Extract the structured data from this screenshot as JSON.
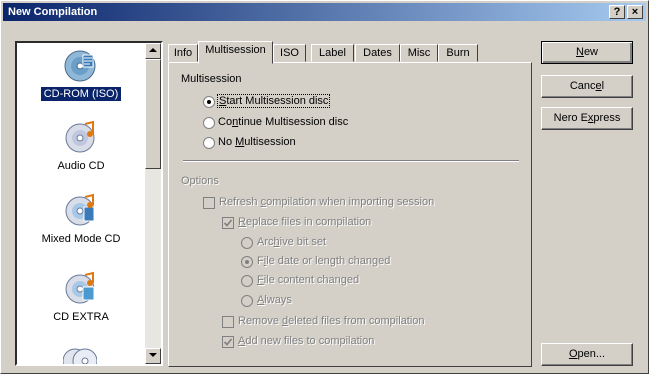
{
  "window": {
    "title": "New Compilation",
    "help_label": "?",
    "close_label": "×"
  },
  "list": {
    "items": [
      {
        "label": "CD-ROM (ISO)",
        "selected": true,
        "icon": "disc-iso-icon"
      },
      {
        "label": "Audio CD",
        "selected": false,
        "icon": "audio-cd-icon"
      },
      {
        "label": "Mixed Mode CD",
        "selected": false,
        "icon": "mixed-mode-cd-icon"
      },
      {
        "label": "CD EXTRA",
        "selected": false,
        "icon": "cd-extra-icon"
      },
      {
        "label": "",
        "selected": false,
        "icon": "disc-icon"
      }
    ]
  },
  "tabs": [
    "Info",
    "Multisession",
    "ISO",
    "Label",
    "Dates",
    "Misc",
    "Burn"
  ],
  "active_tab": "Multisession",
  "multisession": {
    "group_label": "Multisession",
    "options": [
      {
        "pre": "",
        "u": "S",
        "post": "tart Multisession disc",
        "checked": true
      },
      {
        "pre": "Co",
        "u": "n",
        "post": "tinue Multisession disc",
        "checked": false
      },
      {
        "pre": "No ",
        "u": "M",
        "post": "ultisession",
        "checked": false
      }
    ]
  },
  "options": {
    "group_label": "Options",
    "refresh": {
      "pre": "Refresh ",
      "u": "c",
      "post": "ompilation when importing session",
      "checked": false
    },
    "replace": {
      "pre": "",
      "u": "R",
      "post": "eplace files in compilation",
      "checked": true
    },
    "radios": [
      {
        "pre": "Arc",
        "u": "h",
        "post": "ive bit set",
        "checked": false
      },
      {
        "pre": "F",
        "u": "i",
        "post": "le date or length changed",
        "checked": true
      },
      {
        "pre": "",
        "u": "F",
        "post": "ile content changed",
        "checked": false
      },
      {
        "pre": "",
        "u": "A",
        "post": "lways",
        "checked": false
      }
    ],
    "remove": {
      "pre": "Remove ",
      "u": "d",
      "post": "eleted files from compilation",
      "checked": false
    },
    "add": {
      "pre": "",
      "u": "A",
      "post": "dd new files to compilation",
      "checked": true
    }
  },
  "buttons": {
    "new": {
      "pre": "",
      "u": "N",
      "post": "ew"
    },
    "cancel": {
      "pre": "Canc",
      "u": "e",
      "post": "l"
    },
    "express": {
      "pre": "Nero E",
      "u": "x",
      "post": "press"
    },
    "open": {
      "pre": "",
      "u": "O",
      "post": "pen..."
    }
  }
}
